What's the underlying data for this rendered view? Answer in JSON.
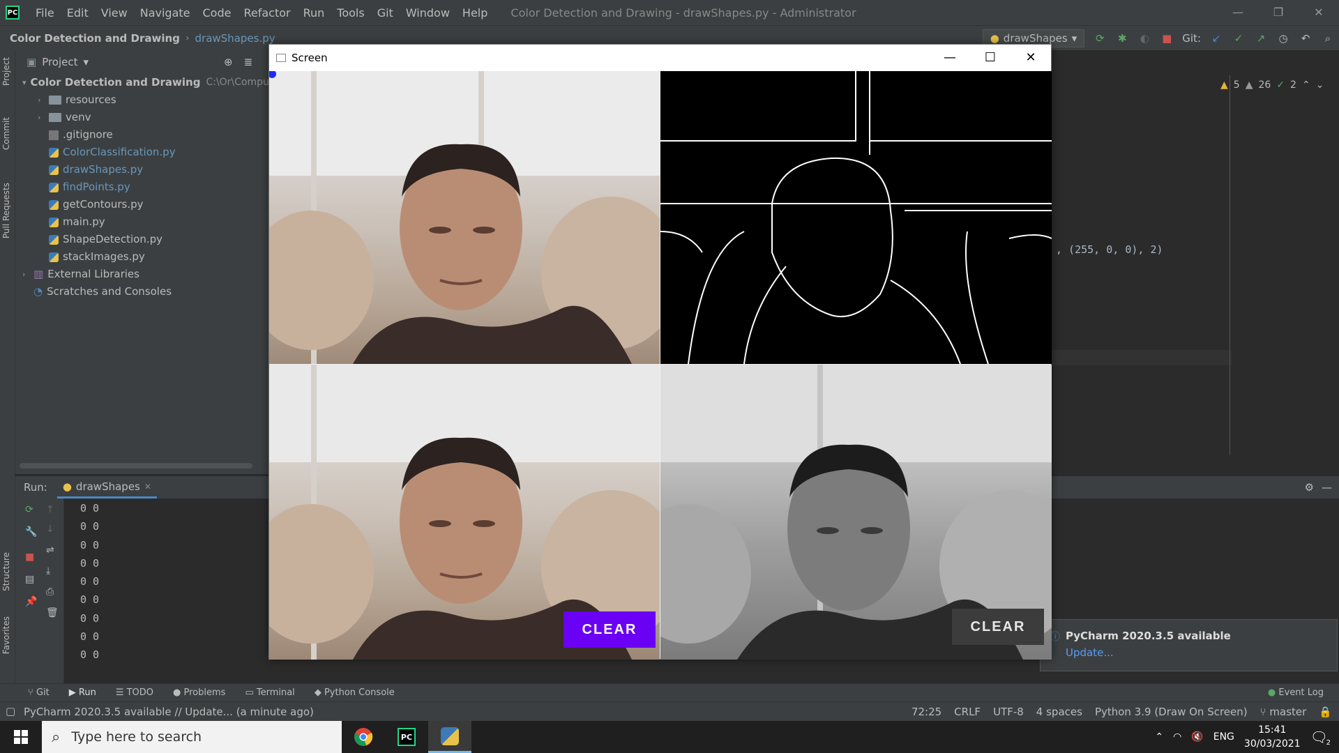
{
  "app": {
    "menu": [
      "File",
      "Edit",
      "View",
      "Navigate",
      "Code",
      "Refactor",
      "Run",
      "Tools",
      "Git",
      "Window",
      "Help"
    ],
    "window_title": "Color Detection and Drawing - drawShapes.py - Administrator"
  },
  "nav": {
    "project": "Color Detection and Drawing",
    "file": "drawShapes.py",
    "run_config": "drawShapes",
    "git_label": "Git:"
  },
  "sidebar_tabs": [
    "Project",
    "Commit",
    "Pull Requests",
    "Structure",
    "Favorites"
  ],
  "project_panel": {
    "title": "Project",
    "root": "Color Detection and Drawing",
    "root_path": "C:\\Or\\Comput",
    "items": [
      {
        "name": "resources",
        "type": "folder"
      },
      {
        "name": "venv",
        "type": "folder"
      },
      {
        "name": ".gitignore",
        "type": "file"
      },
      {
        "name": "ColorClassification.py",
        "type": "py"
      },
      {
        "name": "drawShapes.py",
        "type": "py"
      },
      {
        "name": "findPoints.py",
        "type": "py"
      },
      {
        "name": "getContours.py",
        "type": "py"
      },
      {
        "name": "main.py",
        "type": "py"
      },
      {
        "name": "ShapeDetection.py",
        "type": "py"
      },
      {
        "name": "stackImages.py",
        "type": "py"
      }
    ],
    "external_libraries": "External Libraries",
    "scratches": "Scratches and Consoles"
  },
  "editor": {
    "code_fragment": ", (255, 0, 0), 2)",
    "warnings": "5",
    "weak_warnings": "26",
    "typos": "2"
  },
  "run_panel": {
    "label": "Run:",
    "tab": "drawShapes",
    "output": [
      "0 0",
      "0 0",
      "0 0",
      "0 0",
      "0 0",
      "0 0",
      "0 0",
      "0 0",
      "0 0"
    ]
  },
  "screen_window": {
    "title": "Screen",
    "clear_button_color": "CLEAR",
    "clear_button_gray": "CLEAR",
    "button_color_hex": "#6a00f4"
  },
  "notification": {
    "title": "PyCharm 2020.3.5 available",
    "link": "Update..."
  },
  "bottom_tabs": [
    "Git",
    "Run",
    "TODO",
    "Problems",
    "Terminal",
    "Python Console"
  ],
  "event_log": "Event Log",
  "status": {
    "message": "PyCharm 2020.3.5 available // Update... (a minute ago)",
    "position": "72:25",
    "line_sep": "CRLF",
    "encoding": "UTF-8",
    "indent": "4 spaces",
    "interpreter": "Python 3.9 (Draw On Screen)",
    "branch": "master"
  },
  "taskbar": {
    "search_placeholder": "Type here to search",
    "lang": "ENG",
    "time": "15:41",
    "date": "30/03/2021",
    "notif_count": "2"
  }
}
